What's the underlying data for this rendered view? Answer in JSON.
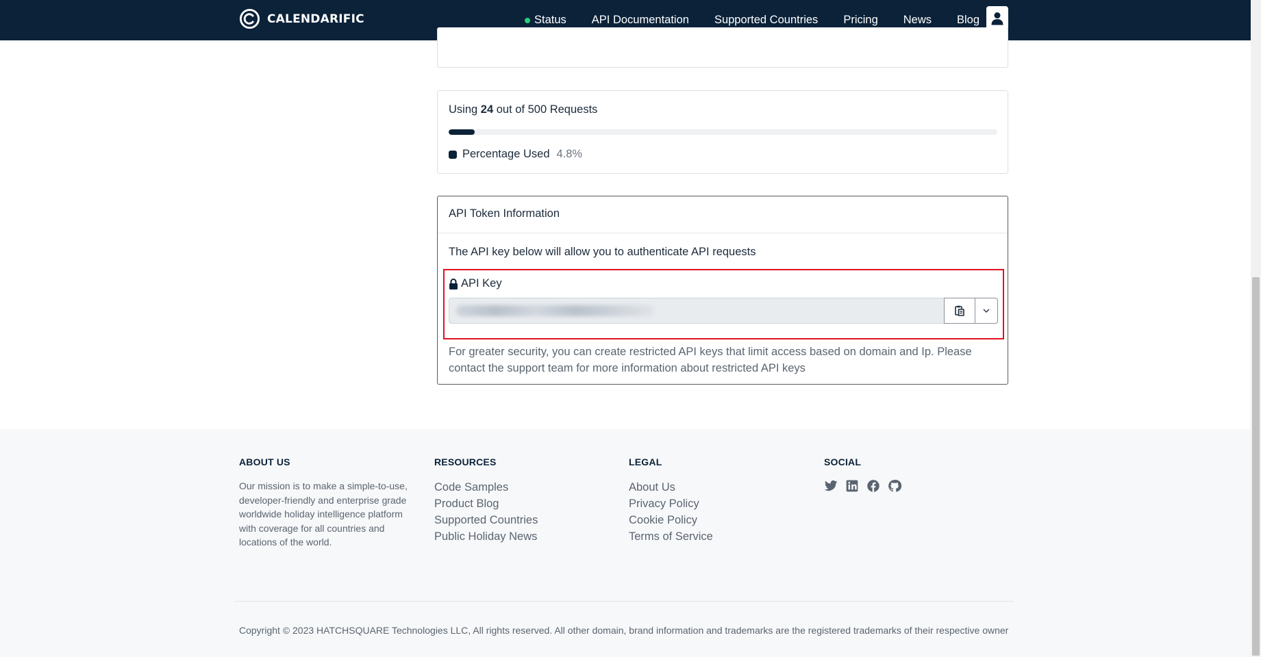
{
  "header": {
    "brand": "CALENDARIFIC",
    "nav": [
      {
        "label": "Status",
        "dot_color": "#26d07c"
      },
      {
        "label": "API Documentation"
      },
      {
        "label": "Supported Countries"
      },
      {
        "label": "Pricing"
      },
      {
        "label": "News"
      },
      {
        "label": "Blog"
      }
    ],
    "background": "#0b2239"
  },
  "usage": {
    "prefix": "Using",
    "used": "24",
    "middle": "out of 500 Requests",
    "legend_label": "Percentage Used",
    "legend_value": "4.8%",
    "percent_used": 4.8
  },
  "token": {
    "title": "API Token Information",
    "description": "The API key below will allow you to authenticate API requests",
    "key_label": "API Key",
    "note": "For greater security, you can create restricted API keys that limit access based on domain and Ip. Please contact the support team for more information about restricted API keys"
  },
  "footer": {
    "about": {
      "heading": "ABOUT US",
      "text": "Our mission is to make a simple-to-use, developer-friendly and enterprise grade worldwide holiday intelligence platform with coverage for all countries and locations of the world."
    },
    "resources": {
      "heading": "RESOURCES",
      "links": [
        "Code Samples",
        "Product Blog",
        "Supported Countries",
        "Public Holiday News"
      ]
    },
    "legal": {
      "heading": "LEGAL",
      "links": [
        "About Us",
        "Privacy Policy",
        "Cookie Policy",
        "Terms of Service"
      ]
    },
    "social": {
      "heading": "SOCIAL",
      "icons": [
        "twitter-icon",
        "linkedin-icon",
        "facebook-icon",
        "github-icon"
      ]
    },
    "copyright": "Copyright © 2023 HATCHSQUARE Technologies LLC, All rights reserved. All other domain, brand information and trademarks are the registered trademarks of their respective owner"
  }
}
